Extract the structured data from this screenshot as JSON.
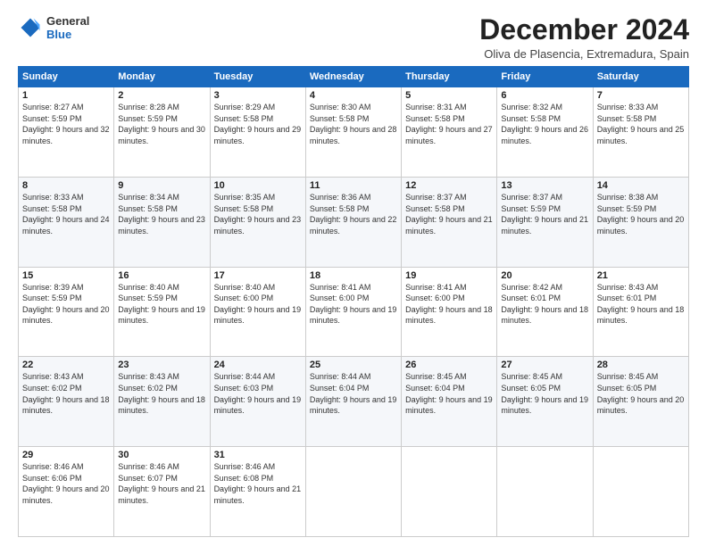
{
  "logo": {
    "line1": "General",
    "line2": "Blue"
  },
  "title": "December 2024",
  "subtitle": "Oliva de Plasencia, Extremadura, Spain",
  "days_of_week": [
    "Sunday",
    "Monday",
    "Tuesday",
    "Wednesday",
    "Thursday",
    "Friday",
    "Saturday"
  ],
  "weeks": [
    [
      {
        "day": "1",
        "sunrise": "8:27 AM",
        "sunset": "5:59 PM",
        "daylight": "9 hours and 32 minutes."
      },
      {
        "day": "2",
        "sunrise": "8:28 AM",
        "sunset": "5:59 PM",
        "daylight": "9 hours and 30 minutes."
      },
      {
        "day": "3",
        "sunrise": "8:29 AM",
        "sunset": "5:58 PM",
        "daylight": "9 hours and 29 minutes."
      },
      {
        "day": "4",
        "sunrise": "8:30 AM",
        "sunset": "5:58 PM",
        "daylight": "9 hours and 28 minutes."
      },
      {
        "day": "5",
        "sunrise": "8:31 AM",
        "sunset": "5:58 PM",
        "daylight": "9 hours and 27 minutes."
      },
      {
        "day": "6",
        "sunrise": "8:32 AM",
        "sunset": "5:58 PM",
        "daylight": "9 hours and 26 minutes."
      },
      {
        "day": "7",
        "sunrise": "8:33 AM",
        "sunset": "5:58 PM",
        "daylight": "9 hours and 25 minutes."
      }
    ],
    [
      {
        "day": "8",
        "sunrise": "8:33 AM",
        "sunset": "5:58 PM",
        "daylight": "9 hours and 24 minutes."
      },
      {
        "day": "9",
        "sunrise": "8:34 AM",
        "sunset": "5:58 PM",
        "daylight": "9 hours and 23 minutes."
      },
      {
        "day": "10",
        "sunrise": "8:35 AM",
        "sunset": "5:58 PM",
        "daylight": "9 hours and 23 minutes."
      },
      {
        "day": "11",
        "sunrise": "8:36 AM",
        "sunset": "5:58 PM",
        "daylight": "9 hours and 22 minutes."
      },
      {
        "day": "12",
        "sunrise": "8:37 AM",
        "sunset": "5:58 PM",
        "daylight": "9 hours and 21 minutes."
      },
      {
        "day": "13",
        "sunrise": "8:37 AM",
        "sunset": "5:59 PM",
        "daylight": "9 hours and 21 minutes."
      },
      {
        "day": "14",
        "sunrise": "8:38 AM",
        "sunset": "5:59 PM",
        "daylight": "9 hours and 20 minutes."
      }
    ],
    [
      {
        "day": "15",
        "sunrise": "8:39 AM",
        "sunset": "5:59 PM",
        "daylight": "9 hours and 20 minutes."
      },
      {
        "day": "16",
        "sunrise": "8:40 AM",
        "sunset": "5:59 PM",
        "daylight": "9 hours and 19 minutes."
      },
      {
        "day": "17",
        "sunrise": "8:40 AM",
        "sunset": "6:00 PM",
        "daylight": "9 hours and 19 minutes."
      },
      {
        "day": "18",
        "sunrise": "8:41 AM",
        "sunset": "6:00 PM",
        "daylight": "9 hours and 19 minutes."
      },
      {
        "day": "19",
        "sunrise": "8:41 AM",
        "sunset": "6:00 PM",
        "daylight": "9 hours and 18 minutes."
      },
      {
        "day": "20",
        "sunrise": "8:42 AM",
        "sunset": "6:01 PM",
        "daylight": "9 hours and 18 minutes."
      },
      {
        "day": "21",
        "sunrise": "8:43 AM",
        "sunset": "6:01 PM",
        "daylight": "9 hours and 18 minutes."
      }
    ],
    [
      {
        "day": "22",
        "sunrise": "8:43 AM",
        "sunset": "6:02 PM",
        "daylight": "9 hours and 18 minutes."
      },
      {
        "day": "23",
        "sunrise": "8:43 AM",
        "sunset": "6:02 PM",
        "daylight": "9 hours and 18 minutes."
      },
      {
        "day": "24",
        "sunrise": "8:44 AM",
        "sunset": "6:03 PM",
        "daylight": "9 hours and 19 minutes."
      },
      {
        "day": "25",
        "sunrise": "8:44 AM",
        "sunset": "6:04 PM",
        "daylight": "9 hours and 19 minutes."
      },
      {
        "day": "26",
        "sunrise": "8:45 AM",
        "sunset": "6:04 PM",
        "daylight": "9 hours and 19 minutes."
      },
      {
        "day": "27",
        "sunrise": "8:45 AM",
        "sunset": "6:05 PM",
        "daylight": "9 hours and 19 minutes."
      },
      {
        "day": "28",
        "sunrise": "8:45 AM",
        "sunset": "6:05 PM",
        "daylight": "9 hours and 20 minutes."
      }
    ],
    [
      {
        "day": "29",
        "sunrise": "8:46 AM",
        "sunset": "6:06 PM",
        "daylight": "9 hours and 20 minutes."
      },
      {
        "day": "30",
        "sunrise": "8:46 AM",
        "sunset": "6:07 PM",
        "daylight": "9 hours and 21 minutes."
      },
      {
        "day": "31",
        "sunrise": "8:46 AM",
        "sunset": "6:08 PM",
        "daylight": "9 hours and 21 minutes."
      },
      null,
      null,
      null,
      null
    ]
  ]
}
